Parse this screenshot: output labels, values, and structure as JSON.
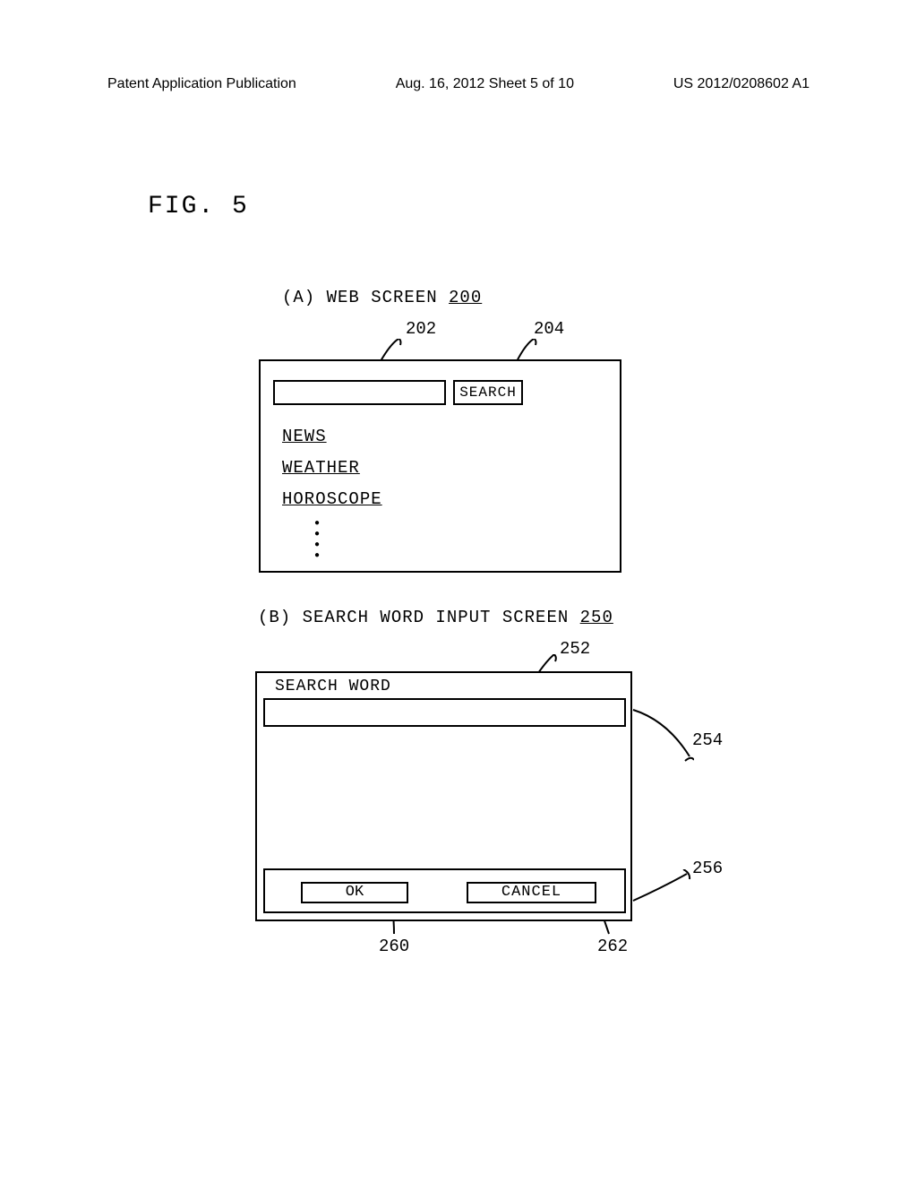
{
  "header": {
    "left": "Patent Application Publication",
    "center": "Aug. 16, 2012  Sheet 5 of 10",
    "right": "US 2012/0208602 A1"
  },
  "figure_label": "FIG. 5",
  "panel_a": {
    "caption_prefix": "(A)  WEB SCREEN ",
    "caption_num": "200",
    "ref_202": "202",
    "ref_204": "204",
    "search_button": "SEARCH",
    "link_news": "NEWS",
    "link_weather": "WEATHER",
    "link_horoscope": "HOROSCOPE"
  },
  "panel_b": {
    "caption_prefix": "(B)  SEARCH WORD INPUT SCREEN  ",
    "caption_num": "250",
    "ref_252": "252",
    "ref_254": "254",
    "ref_256": "256",
    "ref_260": "260",
    "ref_262": "262",
    "search_word_label": "SEARCH WORD",
    "ok_button": "OK",
    "cancel_button": "CANCEL"
  }
}
